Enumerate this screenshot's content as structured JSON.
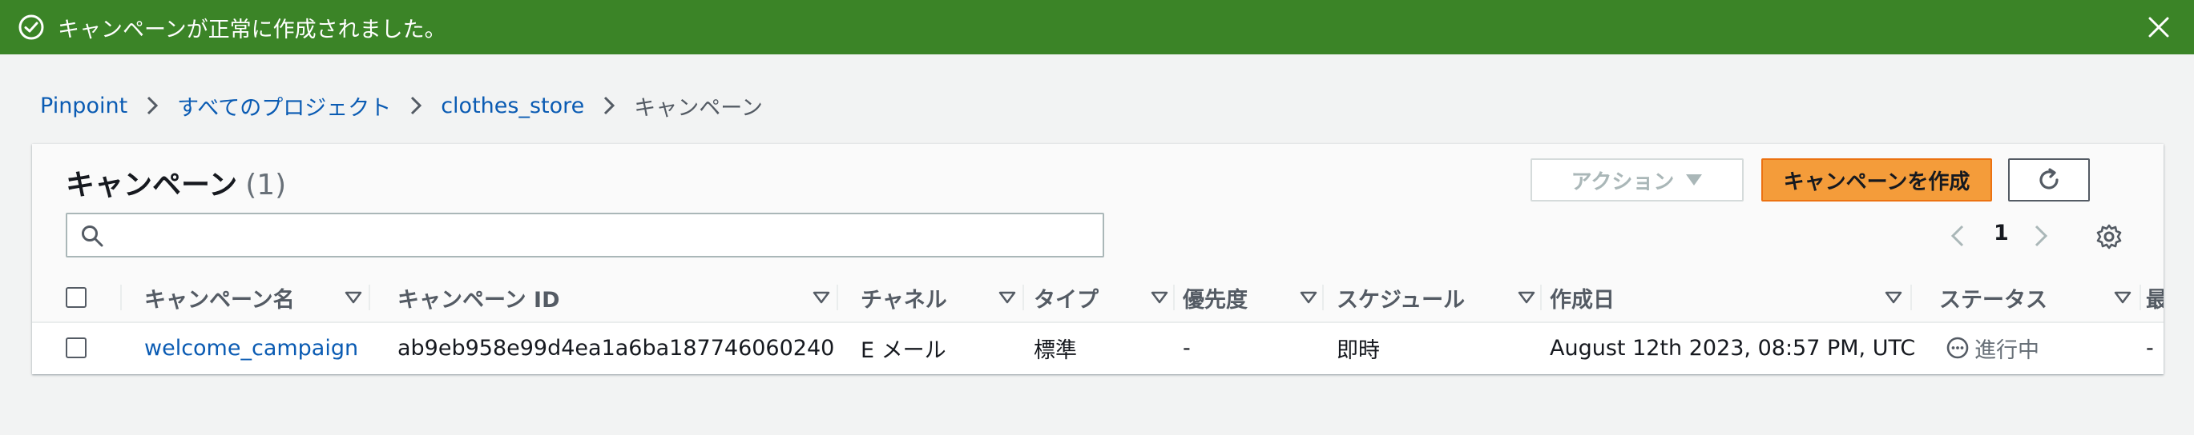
{
  "flash": {
    "message": "キャンペーンが正常に作成されました。",
    "icons": {
      "status": "check-circle-icon",
      "dismiss": "close-icon"
    },
    "color": "#3b8427"
  },
  "breadcrumb": {
    "items": [
      "Pinpoint",
      "すべてのプロジェクト",
      "clothes_store"
    ],
    "current": "キャンペーン"
  },
  "panel": {
    "title": "キャンペーン",
    "count": "(1)",
    "actions_label": "アクション",
    "create_label": "キャンペーンを作成",
    "search_placeholder": "",
    "page_number": "1",
    "icons": {
      "refresh": "refresh-icon",
      "search": "search-icon",
      "prev": "chevron-left-icon",
      "next": "chevron-right-icon",
      "settings": "gear-icon"
    }
  },
  "table": {
    "columns": [
      "キャンペーン名",
      "キャンペーン ID",
      "チャネル",
      "タイプ",
      "優先度",
      "スケジュール",
      "作成日",
      "ステータス",
      "最"
    ],
    "rows": [
      {
        "name": "welcome_campaign",
        "id": "ab9eb958e99d4ea1a6ba187746060240",
        "channel": "E メール",
        "type": "標準",
        "priority": "-",
        "schedule": "即時",
        "created": "August 12th 2023, 08:57 PM, UTC",
        "status": "進行中",
        "last": "-"
      }
    ]
  },
  "colors": {
    "accent_orange": "#f49c3a",
    "link_blue": "#0a5bb3",
    "success_green": "#3b8427"
  }
}
